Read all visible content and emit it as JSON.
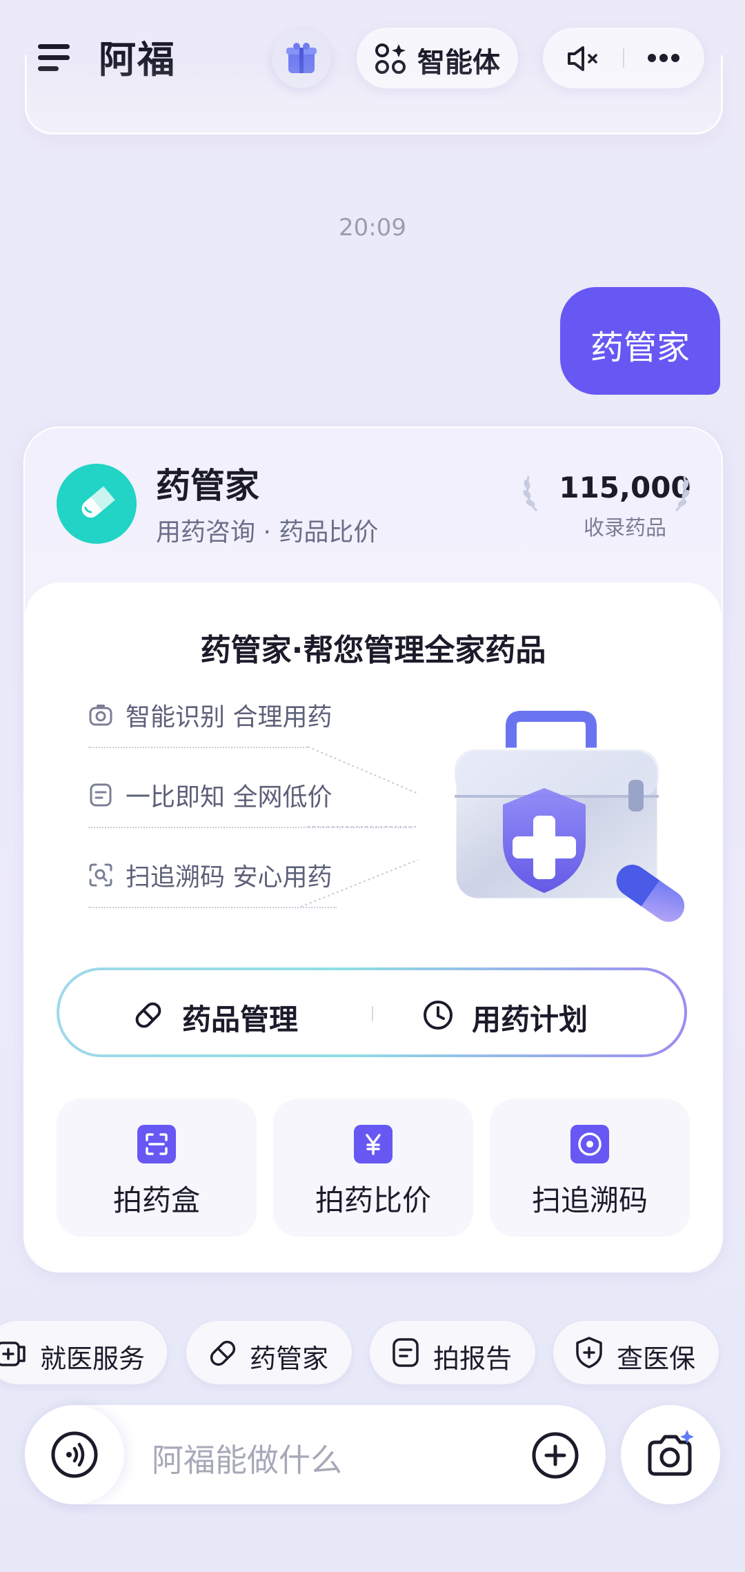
{
  "header": {
    "title": "阿福",
    "agent_label": "智能体"
  },
  "chat": {
    "timestamp": "20:09",
    "user_message": "药管家"
  },
  "card": {
    "name": "药管家",
    "subtitle": "用药咨询 · 药品比价",
    "stat_value": "115,000",
    "stat_label": "收录药品",
    "inner_title": "药管家·帮您管理全家药品",
    "features": [
      {
        "label": "智能识别 合理用药",
        "icon": "camera-icon"
      },
      {
        "label": "一比即知 全网低价",
        "icon": "receipt-icon"
      },
      {
        "label": "扫追溯码 安心用药",
        "icon": "scan-search-icon"
      }
    ],
    "segments": [
      {
        "label": "药品管理",
        "icon": "pill-icon"
      },
      {
        "label": "用药计划",
        "icon": "clock-icon"
      }
    ],
    "tiles": [
      {
        "label": "拍药盒",
        "icon": "scan-frame-icon"
      },
      {
        "label": "拍药比价",
        "icon": "yuan-icon"
      },
      {
        "label": "扫追溯码",
        "icon": "target-icon"
      }
    ]
  },
  "suggestions": [
    {
      "label": "就医服务",
      "icon": "medical-icon"
    },
    {
      "label": "药管家",
      "icon": "pill-icon"
    },
    {
      "label": "拍报告",
      "icon": "document-icon"
    },
    {
      "label": "查医保",
      "icon": "shield-plus-icon"
    }
  ],
  "input": {
    "placeholder": "阿福能做什么"
  },
  "colors": {
    "accent": "#6758f4",
    "teal": "#21d4c5"
  }
}
